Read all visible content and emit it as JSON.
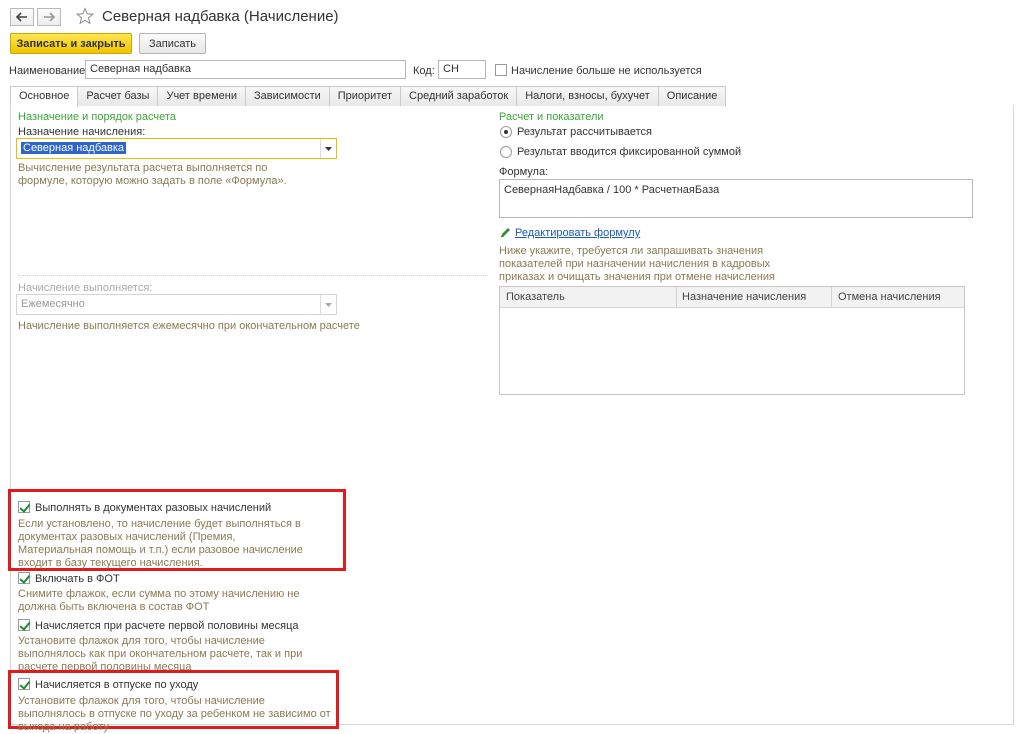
{
  "window": {
    "title": "Северная надбавка (Начисление)"
  },
  "toolbar": {
    "save_close_label": "Записать и закрыть",
    "save_label": "Записать"
  },
  "header": {
    "name_label": "Наименование:",
    "name_value": "Северная надбавка",
    "code_label": "Код:",
    "code_value": "СН",
    "not_used_label": "Начисление больше не используется",
    "not_used_checked": false
  },
  "tabs": [
    {
      "label": "Основное",
      "active": true
    },
    {
      "label": "Расчет базы"
    },
    {
      "label": "Учет времени"
    },
    {
      "label": "Зависимости"
    },
    {
      "label": "Приоритет"
    },
    {
      "label": "Средний заработок"
    },
    {
      "label": "Налоги, взносы, бухучет"
    },
    {
      "label": "Описание"
    }
  ],
  "left": {
    "section_title": "Назначение и порядок расчета",
    "purpose_label": "Назначение начисления:",
    "purpose_value": "Северная надбавка",
    "purpose_hint": "Вычисление результата расчета выполняется по формуле, которую можно задать в поле «Формула».",
    "performed_label": "Начисление выполняется:",
    "performed_value": "Ежемесячно",
    "performed_hint": "Начисление выполняется ежемесячно при окончательном расчете"
  },
  "right": {
    "section_title": "Расчет и показатели",
    "radio_calc": "Результат рассчитывается",
    "radio_fixed": "Результат вводится фиксированной суммой",
    "formula_label": "Формула:",
    "formula_value": "СевернаяНадбавка / 100 * РасчетнаяБаза",
    "edit_formula_link": "Редактировать формулу",
    "indicators_hint": "Ниже укажите, требуется ли запрашивать значения показателей при назначении начисления в кадровых приказах и очищать значения при отмене начисления",
    "table_headers": [
      "Показатель",
      "Назначение начисления",
      "Отмена начисления"
    ]
  },
  "checkboxes": [
    {
      "label": "Выполнять в документах разовых начислений",
      "checked": true,
      "hint": "Если установлено, то начисление будет выполняться в документах разовых начислений (Премия, Материальная помощь и т.п.) если разовое начисление входит в базу текущего начисления."
    },
    {
      "label": "Включать в ФОТ",
      "checked": true,
      "hint": "Снимите флажок, если сумма по этому начислению не должна быть включена в состав ФОТ"
    },
    {
      "label": "Начисляется при расчете первой половины месяца",
      "checked": true,
      "hint": "Установите флажок для того, чтобы начисление выполнялось как при окончательном расчете, так и при расчете первой половины месяца"
    },
    {
      "label": "Начисляется в отпуске по уходу",
      "checked": true,
      "hint": "Установите флажок для того, чтобы начисление выполнялось в отпуске по уходу за ребенком не зависимо от выхода на работу"
    }
  ],
  "colors": {
    "accent_green": "#3aa63a",
    "primary_button": "#f5d11a",
    "highlight_red": "#e11b1b",
    "hint_text": "#8b7a55",
    "link_blue": "#1a5bb5"
  }
}
